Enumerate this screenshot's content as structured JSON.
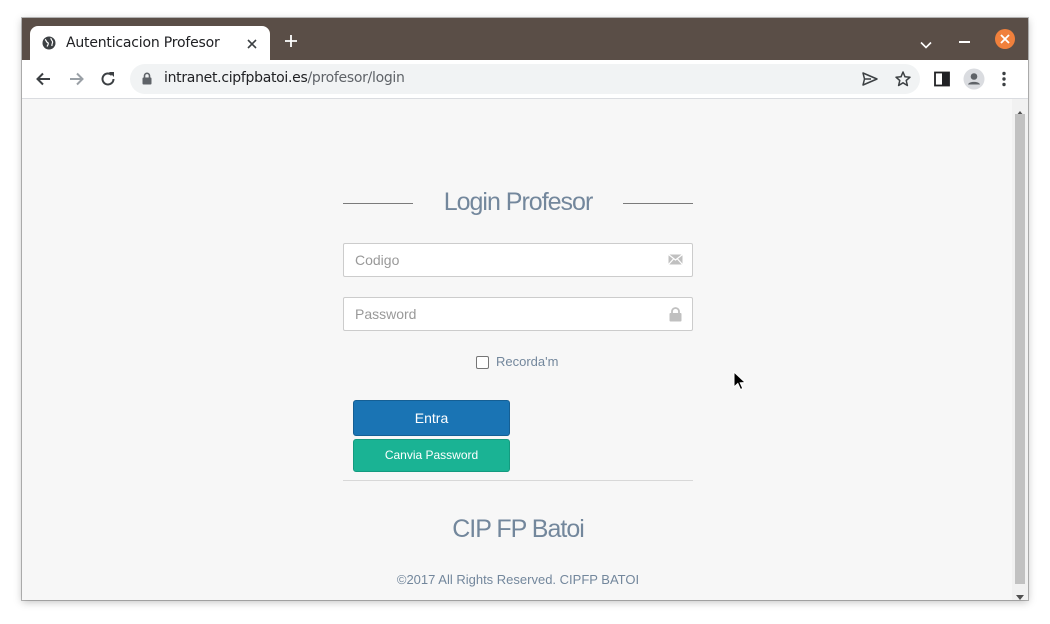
{
  "browser": {
    "tab_title": "Autenticacion Profesor",
    "url_host": "intranet.cipfpbatoi.es",
    "url_path": "/profesor/login",
    "icons": {
      "favicon": "globe-icon",
      "tab_close": "close-icon",
      "new_tab": "plus-icon",
      "tab_search": "chevron-down-icon",
      "minimize": "minimize-icon",
      "window_close": "close-icon",
      "back": "arrow-left-icon",
      "forward": "arrow-right-icon",
      "reload": "reload-icon",
      "lock": "lock-icon",
      "send": "send-icon",
      "bookmark": "star-icon",
      "side_panel": "side-panel-icon",
      "profile": "profile-icon",
      "menu": "kebab-menu-icon"
    },
    "colors": {
      "titlebar": "#5a4e47",
      "close_accent": "#f0803c"
    }
  },
  "login": {
    "heading": "Login Profesor",
    "code_placeholder": "Codigo",
    "password_placeholder": "Password",
    "remember_label": "Recorda'm",
    "remember_checked": false,
    "submit_label": "Entra",
    "change_password_label": "Canvia Password",
    "brand": "CIP FP Batoi",
    "copyright": "©2017 All Rights Reserved. CIPFP BATOI",
    "icons": {
      "code_field": "envelope-icon",
      "password_field": "lock-icon"
    },
    "colors": {
      "text": "#73879c",
      "primary_button": "#1a74b4",
      "secondary_button": "#1ab394"
    }
  }
}
